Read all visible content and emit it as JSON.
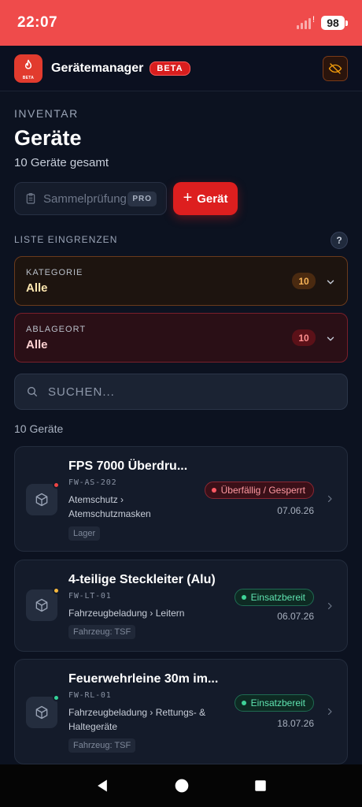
{
  "status_bar": {
    "time": "22:07",
    "battery": "98"
  },
  "app_bar": {
    "title": "Gerätemanager",
    "badge": "BETA",
    "logo_badge": "BETA"
  },
  "header": {
    "eyebrow": "INVENTAR",
    "title": "Geräte",
    "subtitle": "10 Geräte gesamt"
  },
  "actions": {
    "bulk_check_label": "Sammelprüfung",
    "bulk_check_tag": "PRO",
    "add_label": "Gerät"
  },
  "filters": {
    "section_label": "LISTE EINGRENZEN",
    "help_glyph": "?",
    "category": {
      "label": "KATEGORIE",
      "value": "Alle",
      "count": "10"
    },
    "location": {
      "label": "ABLAGEORT",
      "value": "Alle",
      "count": "10"
    }
  },
  "search": {
    "placeholder": "SUCHEN..."
  },
  "results": {
    "count_label": "10 Geräte"
  },
  "devices": [
    {
      "title": "FPS 7000 Überdru...",
      "code": "FW-AS-202",
      "path_line1": "Atemschutz ›",
      "path_line2": "Atemschutzmasken",
      "location": "Lager",
      "status": "Überfällig / Gesperrt",
      "date": "07.06.26",
      "dot_color": "#ef4444",
      "status_kind": "red"
    },
    {
      "title": "4-teilige Steckleiter (Alu)",
      "code": "FW-LT-01",
      "path_line1": "Fahrzeugbeladung › Leitern",
      "path_line2": "",
      "location": "Fahrzeug: TSF",
      "status": "Einsatzbereit",
      "date": "06.07.26",
      "dot_color": "#f5b83d",
      "status_kind": "green"
    },
    {
      "title": "Feuerwehrleine 30m im...",
      "code": "FW-RL-01",
      "path_line1": "Fahrzeugbeladung › Rettungs- &",
      "path_line2": "Haltegeräte",
      "location": "Fahrzeug: TSF",
      "status": "Einsatzbereit",
      "date": "18.07.26",
      "dot_color": "#34d399",
      "status_kind": "green"
    }
  ],
  "colors": {
    "accent": "#dd1f1f",
    "status_bar": "#ef4b4b",
    "background": "#0c1220"
  }
}
